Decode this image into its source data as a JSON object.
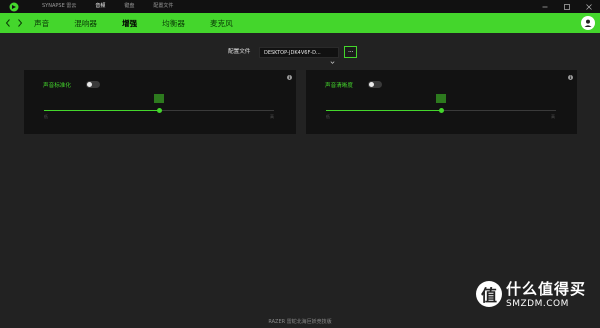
{
  "titlebar": {
    "nav": [
      "SYNAPSE 雷云",
      "音频",
      "键盘",
      "配置文件"
    ],
    "active_index": 1,
    "window_controls": [
      "minimize-icon",
      "maximize-icon",
      "close-icon"
    ]
  },
  "subnav": {
    "tabs": [
      "声音",
      "混响器",
      "增强",
      "均衡器",
      "麦克风"
    ],
    "active_index": 2
  },
  "profile": {
    "label": "配置文件",
    "value": "DESKTOP-JDK4V6F-D...",
    "more_label": "···"
  },
  "panels": [
    {
      "title": "声音标准化",
      "toggle_on": false,
      "slider_level": 0.5,
      "min_label": "低",
      "max_label": "高"
    },
    {
      "title": "声音清晰度",
      "toggle_on": false,
      "slider_level": 0.5,
      "min_label": "低",
      "max_label": "高"
    }
  ],
  "info_label": "i",
  "footer": "RAZER 雷蛇北海巨妖竞技版",
  "watermark": {
    "char": "值",
    "line1": "什么值得买",
    "line2": "SMZDM.COM"
  },
  "colors": {
    "accent": "#44d62c",
    "background": "#222222",
    "panel": "#121212",
    "titlebar": "#111111"
  }
}
